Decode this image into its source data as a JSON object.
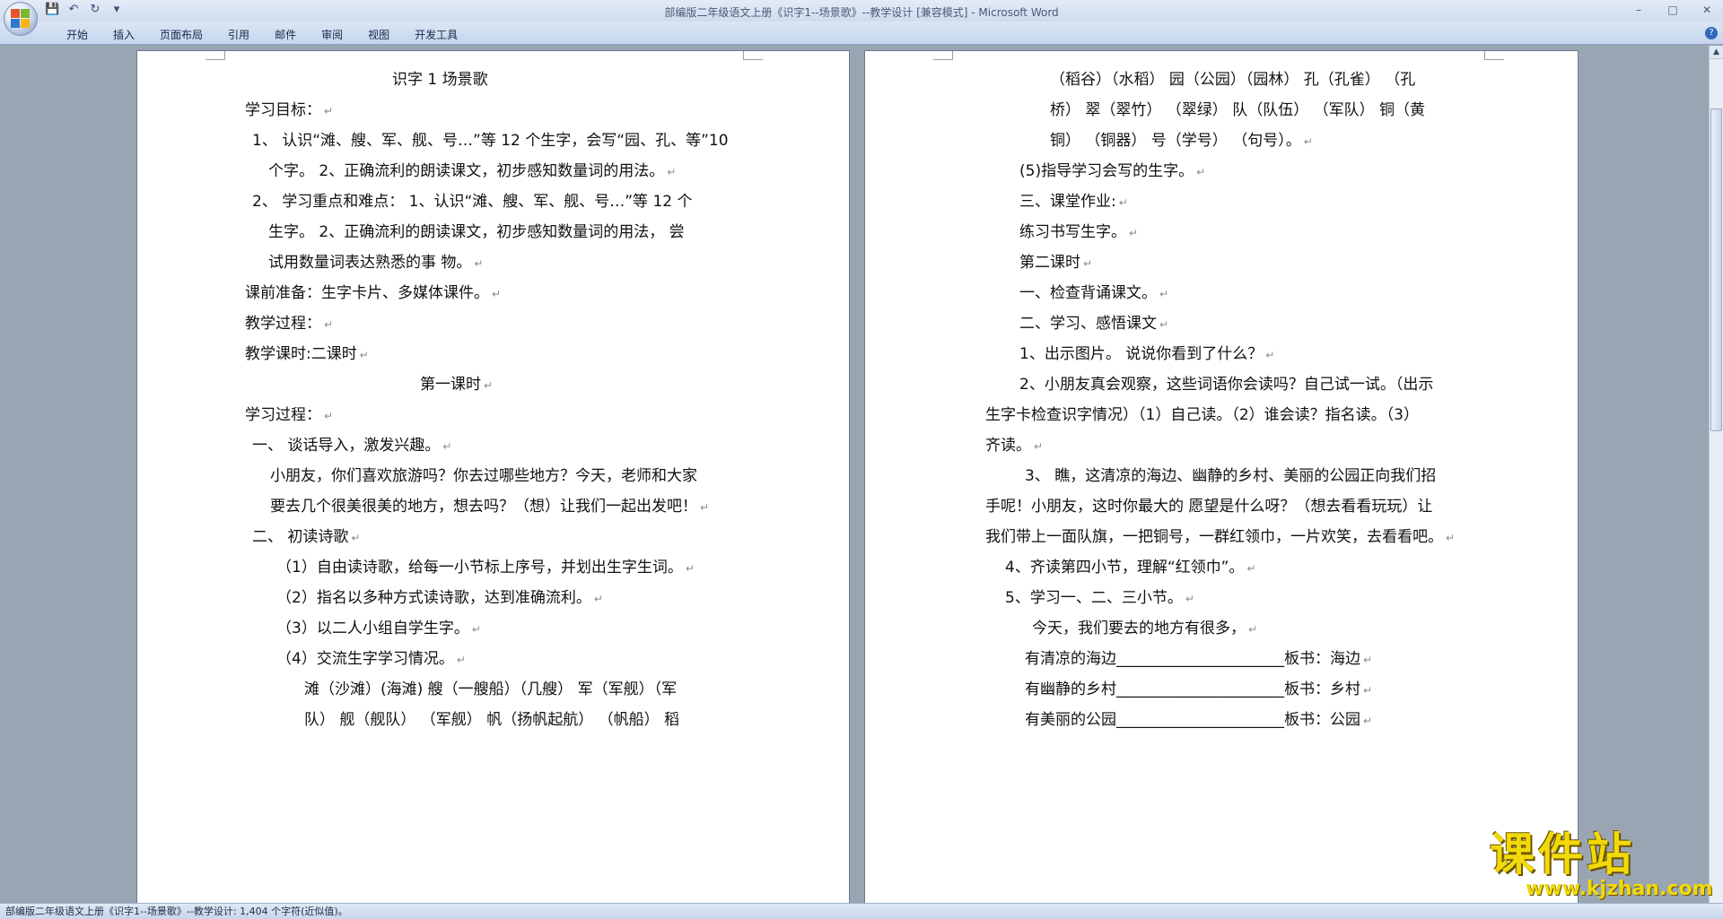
{
  "window": {
    "title": "部编版二年级语文上册《识字1--场景歌》--教学设计 [兼容模式] - Microsoft Word",
    "controls": [
      "–",
      "□",
      "✕"
    ]
  },
  "qat": {
    "save": "💾",
    "undo": "↶",
    "redo": "↻",
    "more": "▾"
  },
  "ribbon": {
    "tabs": [
      "开始",
      "插入",
      "页面布局",
      "引用",
      "邮件",
      "审阅",
      "视图",
      "开发工具"
    ],
    "help": "?"
  },
  "pilcrow": "↵",
  "left_page": [
    {
      "text": "识字 1       场景歌"
    },
    {
      "text": "学习目标：",
      "pm": true
    },
    {
      "text": "1、   认识“滩、艘、军、舰、号…”等  12  个生字，会写“园、孔、等”10"
    },
    {
      "text": "个字。 2、正确流利的朗读课文，初步感知数量词的用法。",
      "pm": true
    },
    {
      "text": "2、   学习重点和难点：  1、认识“滩、艘、军、舰、号…”等  12  个"
    },
    {
      "text": "生字。 2、正确流利的朗读课文，初步感知数量词的用法，  尝"
    },
    {
      "text": "试用数量词表达熟悉的事 物。",
      "pm": true
    },
    {
      "text": "课前准备：生字卡片、多媒体课件。",
      "pm": true
    },
    {
      "text": "教学过程：",
      "pm": true
    },
    {
      "text": "教学课时:二课时",
      "pm": true
    },
    {
      "text": "第一课时",
      "pm": true
    },
    {
      "text": "学习过程：",
      "pm": true
    },
    {
      "text": "一、  谈话导入，激发兴趣。",
      "pm": true
    },
    {
      "text": "小朋友，你们喜欢旅游吗？你去过哪些地方？今天，老师和大家"
    },
    {
      "text": "要去几个很美很美的地方，想去吗？（想）让我们一起出发吧！",
      "pm": true
    },
    {
      "text": "二、  初读诗歌",
      "pm": true
    },
    {
      "text": "（1）自由读诗歌，给每一小节标上序号，并划出生字生词。",
      "pm": true
    },
    {
      "text": "（2）指名以多种方式读诗歌，达到准确流利。",
      "pm": true
    },
    {
      "text": "（3）以二人小组自学生字。",
      "pm": true
    },
    {
      "text": "（4）交流生字学习情况。",
      "pm": true
    },
    {
      "text": "滩（沙滩）(海滩)  艘（一艘船）（几艘）  军（军舰）（军"
    },
    {
      "text": "队）  舰（舰队）  （军舰）  帆（扬帆起航）  （帆船）  稻"
    }
  ],
  "right_page": [
    {
      "text": "（稻谷）（水稻） 园（公园）（园林） 孔（孔雀） （孔"
    },
    {
      "text": "桥） 翠（翠竹） （翠绿） 队（队伍） （军队） 铜（黄"
    },
    {
      "text": "铜） （铜器） 号（学号） （句号）。",
      "pm": true
    },
    {
      "text": "(5)指导学习会写的生字。",
      "pm": true
    },
    {
      "text": "三、课堂作业:",
      "pm": true
    },
    {
      "text": "练习书写生字。",
      "pm": true
    },
    {
      "text": "第二课时",
      "pm": true
    },
    {
      "text": "一、检查背诵课文。",
      "pm": true
    },
    {
      "text": "二、学习、感悟课文",
      "pm": true
    },
    {
      "text": "1、出示图片。 说说你看到了什么？",
      "pm": true
    },
    {
      "text": "2、小朋友真会观察，这些词语你会读吗？自己试一试。（出示"
    },
    {
      "text": "生字卡检查识字情况）（1）自己读。（2）谁会读？指名读。（3）"
    },
    {
      "text": "齐读。",
      "pm": true
    },
    {
      "text": "3、  瞧，这清凉的海边、幽静的乡村、美丽的公园正向我们招"
    },
    {
      "text": "手呢！小朋友，这时你最大的 愿望是什么呀？（想去看看玩玩）让"
    },
    {
      "text": "我们带上一面队旗，一把铜号，一群红领巾，一片欢笑，去看看吧。",
      "pm": true
    },
    {
      "text": "4、齐读第四小节，理解“红领巾”。",
      "pm": true
    },
    {
      "text": "5、学习一、二、三小节。",
      "pm": true
    },
    {
      "text": "今天，我们要去的地方有很多，",
      "pm": true
    },
    {
      "text": "有清凉的海边______________________板书：海边",
      "pm": true
    },
    {
      "text": "有幽静的乡村______________________板书：乡村",
      "pm": true
    },
    {
      "text": "有美丽的公园______________________板书：公园",
      "pm": true
    }
  ],
  "status": "部编版二年级语文上册《识字1--场景歌》--教学设计: 1,404 个字符(近似值)。",
  "watermark": {
    "main": "课件站",
    "url": "www.kjzhan.com"
  }
}
